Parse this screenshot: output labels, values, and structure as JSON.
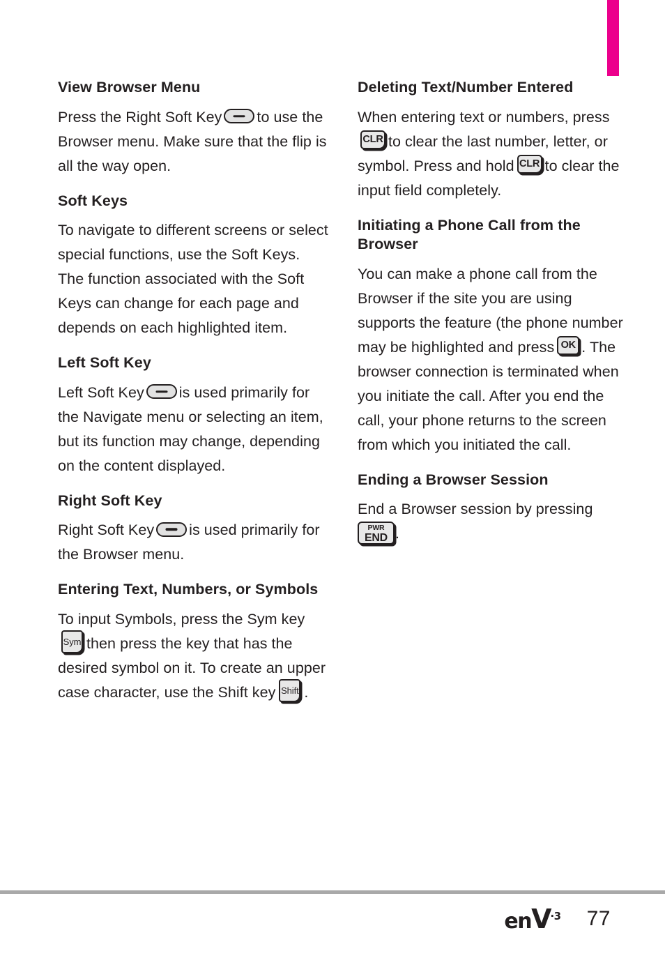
{
  "page": {
    "number": "77",
    "logo": {
      "prefix": "en",
      "mark": "V",
      "superscript": "·3"
    },
    "accent_color": "#ec008c",
    "rule_color": "#a9a9a9",
    "text_color": "#231f20"
  },
  "left_column": {
    "blocks": [
      {
        "heading": "View Browser Menu",
        "text_before": "Press the Right Soft Key",
        "icon": "right-soft-key-icon",
        "text_after": "to use the Browser menu. Make sure that the flip is all the way open."
      },
      {
        "heading": "Soft Keys",
        "text_before": "To navigate to different screens or select special functions, use the Soft Keys. The function associated with the Soft Keys can change for each page and depends on each highlighted item.",
        "icon": null,
        "text_after": ""
      },
      {
        "heading": "Left Soft Key",
        "text_before": "Left Soft Key",
        "icon": "left-soft-key-icon",
        "text_after": "is used primarily for the Navigate menu or selecting an item, but its function may change, depending on the content displayed."
      },
      {
        "heading": "Right Soft Key",
        "text_before": "Right Soft Key",
        "icon": "right-soft-key-icon",
        "text_after": "is used primarily for the Browser menu."
      },
      {
        "heading": "Entering Text, Numbers, or Symbols",
        "text_before": "To input Symbols, press the Sym key",
        "icon": "sym-key-icon",
        "text_mid": "then press the key that has the desired symbol on it. To create an upper case character, use the Shift key",
        "icon2": "shift-key-icon",
        "text_after": "."
      }
    ]
  },
  "right_column": {
    "blocks": [
      {
        "heading": "Deleting Text/Number Entered",
        "text_1": "When entering text or numbers, press",
        "icon_1": "clr-key-icon",
        "text_2": "to clear the last number, letter, or symbol. Press and hold",
        "icon_2": "clr-key-icon",
        "text_3": "to clear the input field completely."
      },
      {
        "heading": "Initiating a Phone Call from the Browser",
        "text_1": "You can make a phone call from the Browser if the site you are using supports the feature (the phone number may be highlighted and press",
        "icon_1": "ok-key-icon",
        "text_2": ". The browser connection is terminated when you initiate the call. After you end the call, your phone returns to the screen from which you initiated the call."
      },
      {
        "heading": "Ending a Browser Session",
        "text_1": "End a Browser session by pressing",
        "icon_1": "end-key-icon",
        "text_2": "."
      }
    ]
  },
  "keys": {
    "clr": "CLR",
    "ok": "OK",
    "sym": "Sym",
    "shift": "Shift",
    "end_top": "PWR",
    "end_bottom": "END"
  }
}
